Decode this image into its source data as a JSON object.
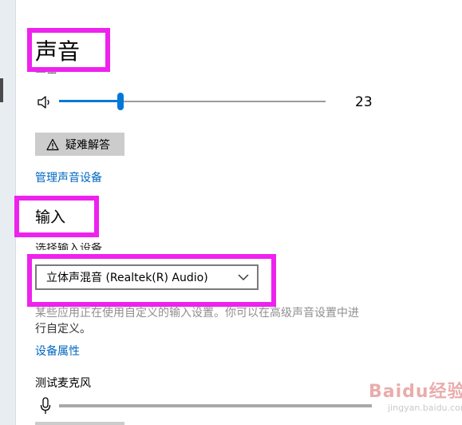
{
  "sound": {
    "title": "声音",
    "volume_label": "音量",
    "volume_value": "23",
    "volume_level": 0.23,
    "troubleshoot_label": "疑难解答",
    "manage_devices_link": "管理声音设备"
  },
  "input": {
    "title": "输入",
    "select_label": "选择输入设备",
    "selected_device": "立体声混音 (Realtek(R) Audio)",
    "description_line1": "某些应用正在使用自定义的输入设置。你可以在高级声音设置中进",
    "description_line2": "行自定义。",
    "device_properties_link": "设备属性",
    "test_mic_label": "测试麦克风"
  },
  "watermark": {
    "logo_text": "Baidu经验",
    "sub_text": "jingyan.baidu.com"
  },
  "colors": {
    "accent": "#0078d7",
    "link": "#0067c0",
    "highlight": "#ee22ee"
  },
  "icons": {
    "speaker": "speaker-icon",
    "warning": "warning-icon",
    "chevron": "chevron-down-icon",
    "microphone": "microphone-icon"
  }
}
